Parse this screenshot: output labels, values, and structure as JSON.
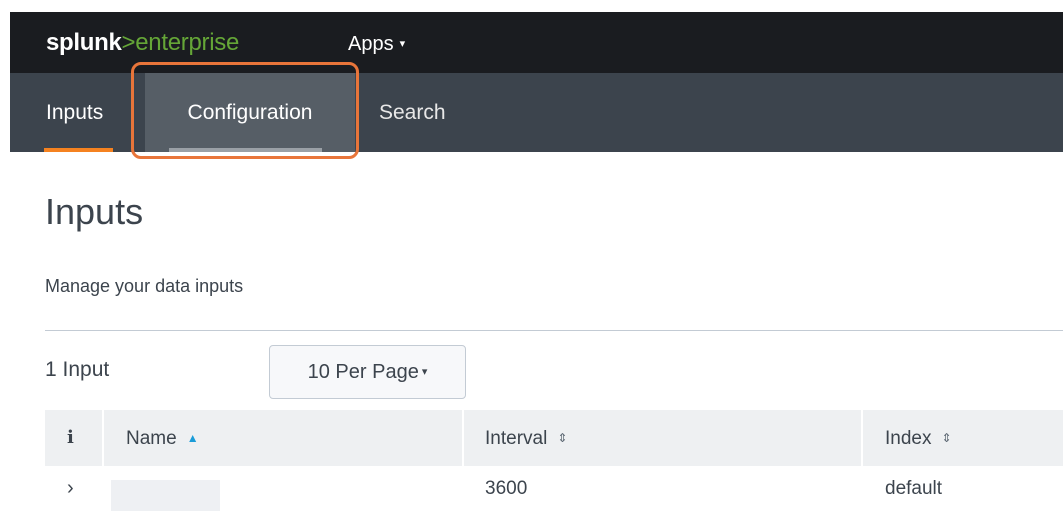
{
  "header": {
    "logo_part1": "splunk",
    "logo_part2": ">enterprise",
    "apps_label": "Apps",
    "apps_caret": "▾"
  },
  "nav": {
    "tabs": [
      {
        "label": "Inputs",
        "active": true
      },
      {
        "label": "Configuration",
        "highlighted": true
      },
      {
        "label": "Search"
      }
    ]
  },
  "page": {
    "title": "Inputs",
    "description": "Manage your data inputs",
    "count_label": "1 Input",
    "per_page": "10 Per Page",
    "per_page_caret": "▾"
  },
  "table": {
    "info_glyph": "i",
    "headers": [
      {
        "label": "Name",
        "sort": "▲"
      },
      {
        "label": "Interval",
        "sort": "⇕"
      },
      {
        "label": "Index",
        "sort": "⇕"
      }
    ],
    "rows": [
      {
        "expander": "›",
        "name": "",
        "interval": "3600",
        "index": "default"
      }
    ]
  },
  "colors": {
    "accent": "#f58220",
    "brand_green": "#65a637",
    "highlight": "#e8753a",
    "sort_active": "#1a9cd8"
  }
}
